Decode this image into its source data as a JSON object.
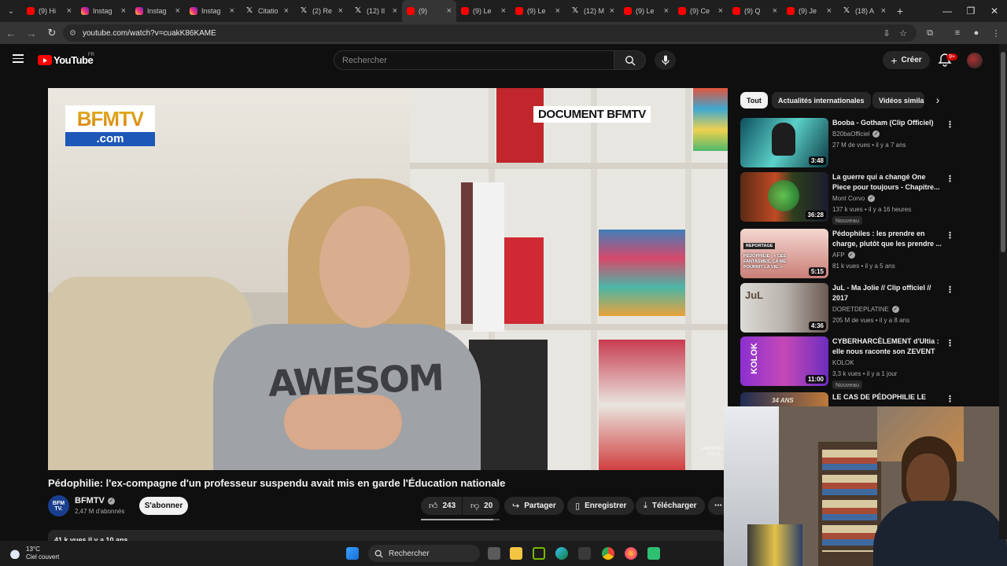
{
  "browser": {
    "tabs": [
      {
        "label": "(9) Hi",
        "icon": "youtube-favicon"
      },
      {
        "label": "Instag",
        "icon": "instagram-favicon"
      },
      {
        "label": "Instag",
        "icon": "instagram-favicon"
      },
      {
        "label": "Instag",
        "icon": "instagram-favicon"
      },
      {
        "label": "Citatio",
        "icon": "x-favicon"
      },
      {
        "label": "(2) Re",
        "icon": "x-favicon"
      },
      {
        "label": "(12) Il",
        "icon": "x-favicon"
      },
      {
        "label": "(9)",
        "icon": "youtube-favicon",
        "active": true
      },
      {
        "label": "(9) Le",
        "icon": "youtube-favicon"
      },
      {
        "label": "(9) Le",
        "icon": "youtube-favicon"
      },
      {
        "label": "(12) M",
        "icon": "x-favicon"
      },
      {
        "label": "(9) Le",
        "icon": "youtube-favicon"
      },
      {
        "label": "(9) Ce",
        "icon": "youtube-favicon"
      },
      {
        "label": "(9) Q",
        "icon": "youtube-favicon"
      },
      {
        "label": "(9) Je",
        "icon": "youtube-favicon"
      },
      {
        "label": "(18) A",
        "icon": "x-favicon"
      }
    ],
    "url": "youtube.com/watch?v=cuakK86KAME"
  },
  "header": {
    "logo_text": "YouTube",
    "region": "FR",
    "search_placeholder": "Rechercher",
    "create_label": "Créer",
    "notif_badge": "9+"
  },
  "video": {
    "overlay_logo_top": "BFMTV",
    "overlay_logo_bottom": ".com",
    "overlay_tag": "DOCUMENT BFMTV",
    "shirt_text": "AWESOM",
    "watermark": "ABONNEZ VOUS",
    "title": "Pédophilie: l'ex-compagne d'un professeur suspendu avait mis en garde l'Éducation nationale",
    "channel": "BFMTV",
    "channel_avatar_text": "BFM TV.",
    "subscribers": "2,47 M d'abonnés",
    "subscribe_label": "S'abonner",
    "likes": "243",
    "dislikes": "20",
    "share_label": "Partager",
    "save_label": "Enregistrer",
    "download_label": "Télécharger",
    "like_ratio": 0.92,
    "description_preview": "41 k vues  il y a 10 ans"
  },
  "chips": [
    {
      "label": "Tout",
      "active": true
    },
    {
      "label": "Actualités internationales"
    },
    {
      "label": "Vidéos simila"
    }
  ],
  "recommendations": [
    {
      "title": "Booba - Gotham (Clip Officiel)",
      "channel": "B20baOfficiel",
      "verified": true,
      "meta": "27 M de vues • il y a 7 ans",
      "duration": "3:48",
      "new": ""
    },
    {
      "title": "La guerre qui a changé One Piece pour toujours - Chapitre...",
      "channel": "Mont Corvo",
      "verified": true,
      "meta": "137 k vues • il y a 16 heures",
      "duration": "36:28",
      "new": "Nouveau"
    },
    {
      "title": "Pédophiles : les prendre en charge, plutôt que les prendre ...",
      "channel": "AFP",
      "verified": true,
      "meta": "81 k vues • il y a 5 ans",
      "duration": "5:15",
      "new": ""
    },
    {
      "title": "JuL - Ma Jolie // Clip officiel // 2017",
      "channel": "DORETDEPLATINE",
      "verified": true,
      "meta": "205 M de vues • il y a 8 ans",
      "duration": "4:36",
      "new": ""
    },
    {
      "title": "CYBERHARCÈLEMENT d'Ultia : elle nous raconte son ZEVENT",
      "channel": "KOLOK",
      "verified": false,
      "meta": "3,3 k vues • il y a 1 jour",
      "duration": "11:00",
      "new": "Nouveau"
    },
    {
      "title": "LE CAS DE PÉDOPHILIE LE",
      "channel": "",
      "verified": false,
      "meta": "",
      "duration": "",
      "new": ""
    }
  ],
  "thumb_captions": {
    "t3_tag": "REPORTAGE",
    "t3_quote": "PÉDOPHILIE : « CES FANTASMES, ÇA ME POURRIT LA VIE. »",
    "t4_text": "JuL",
    "t5_text": "KOLOK",
    "t6_text": "34 ANS"
  },
  "taskbar": {
    "temperature": "13°C",
    "weather": "Ciel couvert",
    "search": "Rechercher"
  },
  "colors": {
    "background": "#0f0f0f",
    "youtube_red": "#ff0000",
    "chip_bg": "#272727"
  }
}
